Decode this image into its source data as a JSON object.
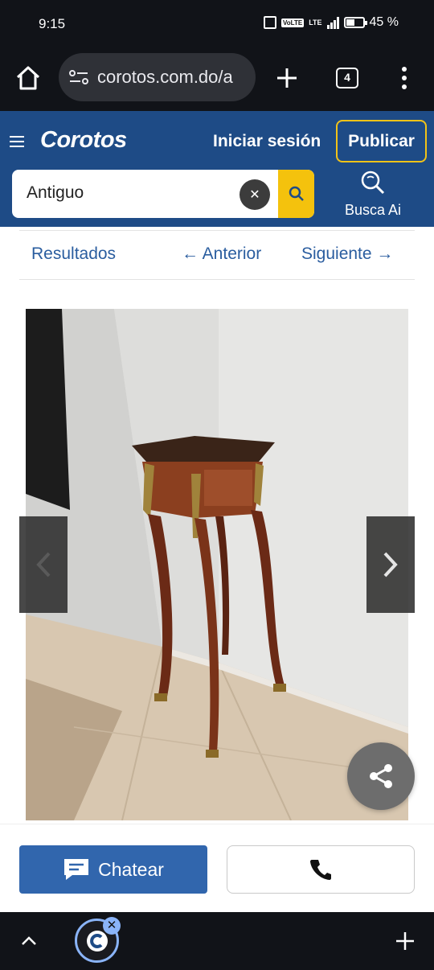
{
  "status_bar": {
    "time": "9:15",
    "network": "VoLTE",
    "lte": "LTE",
    "battery": "45 %"
  },
  "browser": {
    "url": "corotos.com.do/a",
    "tab_count": "4",
    "icons": [
      "home-icon",
      "site-settings-icon",
      "new-tab-icon",
      "tabs-icon",
      "more-menu-icon"
    ]
  },
  "header": {
    "logo": "Corotos",
    "login_label": "Iniciar sesión",
    "publish_label": "Publicar",
    "search_value": "Antiguo",
    "busca_ai_label": "Busca Ai",
    "colors": {
      "header_bg": "#1e4b86",
      "accent": "#f4c20d"
    }
  },
  "pager": {
    "results_label": "Resultados",
    "prev_label": "← Anterior",
    "next_label": "Siguiente →"
  },
  "listing": {
    "image_subject": "antique-side-table-photo"
  },
  "actions": {
    "chat_label": "Chatear",
    "call_icon": "phone-icon",
    "colors": {
      "chat_bg": "#3166ad"
    }
  }
}
